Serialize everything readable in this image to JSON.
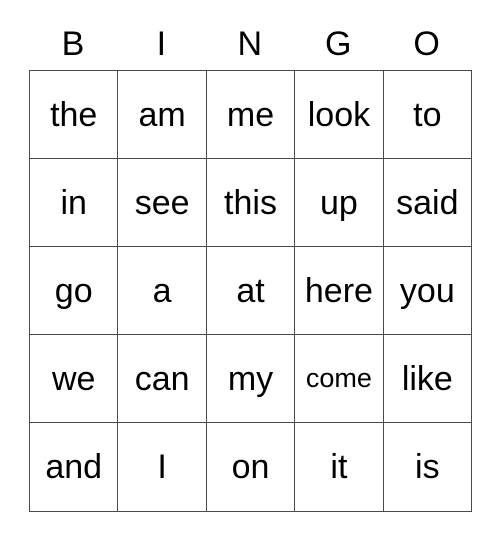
{
  "card": {
    "headers": [
      "B",
      "I",
      "N",
      "G",
      "O"
    ],
    "rows": [
      [
        {
          "text": "the",
          "size": "normal"
        },
        {
          "text": "am",
          "size": "normal"
        },
        {
          "text": "me",
          "size": "normal"
        },
        {
          "text": "look",
          "size": "normal"
        },
        {
          "text": "to",
          "size": "normal"
        }
      ],
      [
        {
          "text": "in",
          "size": "normal"
        },
        {
          "text": "see",
          "size": "normal"
        },
        {
          "text": "this",
          "size": "normal"
        },
        {
          "text": "up",
          "size": "normal"
        },
        {
          "text": "said",
          "size": "normal"
        }
      ],
      [
        {
          "text": "go",
          "size": "normal"
        },
        {
          "text": "a",
          "size": "normal"
        },
        {
          "text": "at",
          "size": "normal"
        },
        {
          "text": "here",
          "size": "normal"
        },
        {
          "text": "you",
          "size": "normal"
        }
      ],
      [
        {
          "text": "we",
          "size": "normal"
        },
        {
          "text": "can",
          "size": "normal"
        },
        {
          "text": "my",
          "size": "normal"
        },
        {
          "text": "come",
          "size": "small"
        },
        {
          "text": "like",
          "size": "normal"
        }
      ],
      [
        {
          "text": "and",
          "size": "normal"
        },
        {
          "text": "I",
          "size": "normal"
        },
        {
          "text": "on",
          "size": "normal"
        },
        {
          "text": "it",
          "size": "normal"
        },
        {
          "text": "is",
          "size": "normal"
        }
      ]
    ]
  },
  "colors": {
    "background": "#ffffff",
    "grid_line": "#4a4a4a",
    "text": "#000000"
  }
}
